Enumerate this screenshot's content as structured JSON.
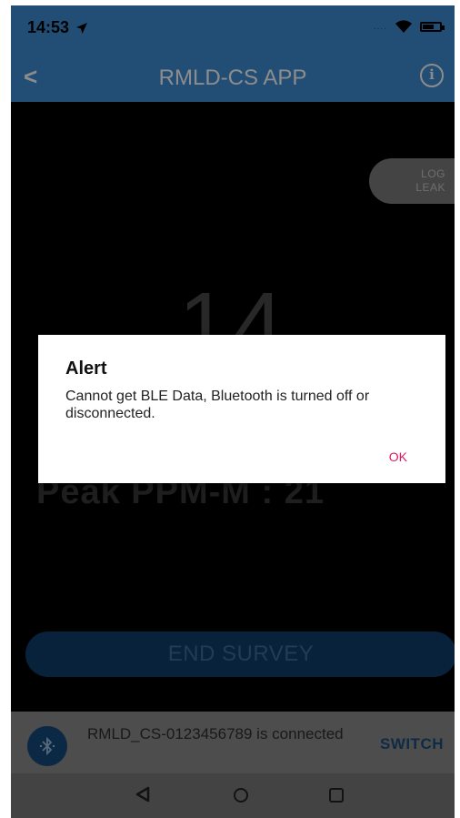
{
  "status_bar": {
    "time": "14:53",
    "location_icon": "location-arrow-icon",
    "signal_icon": "signal-dots-icon",
    "wifi_icon": "wifi-icon",
    "battery_icon": "battery-icon"
  },
  "nav": {
    "back_label": "<",
    "title": "RMLD-CS APP",
    "info_label": "i"
  },
  "main": {
    "log_leak_line1": "LOG",
    "log_leak_line2": "LEAK",
    "ppm_value": "14",
    "peak_label": "Peak PPM-M : 21",
    "end_survey_label": "END SURVEY"
  },
  "alert": {
    "title": "Alert",
    "message": "Cannot get BLE Data, Bluetooth is turned off or disconnected.",
    "ok_label": "OK"
  },
  "connection": {
    "icon": "bluetooth-icon",
    "status_text": "RMLD_CS-0123456789 is connected",
    "switch_label": "SWITCH"
  },
  "colors": {
    "header_blue": "#3f8fd6",
    "button_dark_blue": "#0f3e6c",
    "ok_pink": "#d81b60"
  }
}
